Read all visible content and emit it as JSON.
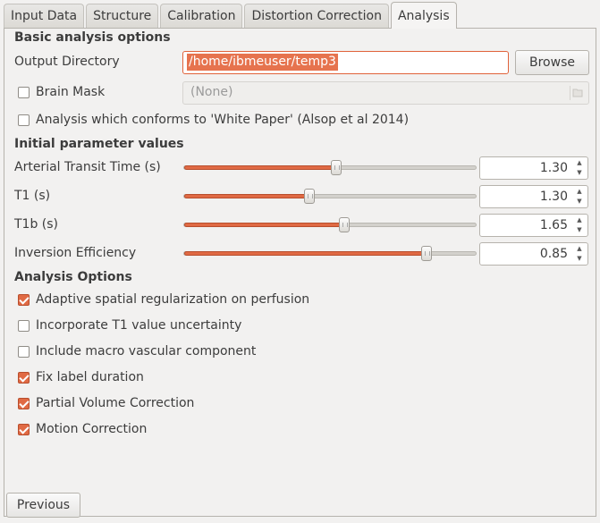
{
  "tabs": [
    "Input Data",
    "Structure",
    "Calibration",
    "Distortion Correction",
    "Analysis"
  ],
  "active_tab": "Analysis",
  "basic": {
    "title": "Basic analysis options",
    "output_dir_label": "Output Directory",
    "output_dir_value": "/home/ibmeuser/temp3",
    "browse_label": "Browse",
    "brain_mask_label": "Brain Mask",
    "brain_mask_value": "(None)",
    "white_paper_label": "Analysis which conforms to 'White Paper' (Alsop et al 2014)"
  },
  "params": {
    "title": "Initial parameter values",
    "items": [
      {
        "label": "Arterial Transit Time (s)",
        "value": "1.30",
        "fraction": 0.52
      },
      {
        "label": "T1 (s)",
        "value": "1.30",
        "fraction": 0.43
      },
      {
        "label": "T1b (s)",
        "value": "1.65",
        "fraction": 0.55
      },
      {
        "label": "Inversion Efficiency",
        "value": "0.85",
        "fraction": 0.83
      }
    ]
  },
  "options": {
    "title": "Analysis Options",
    "items": [
      {
        "label": "Adaptive spatial regularization on perfusion",
        "checked": true
      },
      {
        "label": "Incorporate T1 value uncertainty",
        "checked": false
      },
      {
        "label": "Include macro vascular component",
        "checked": false
      },
      {
        "label": "Fix label duration",
        "checked": true
      },
      {
        "label": "Partial Volume Correction",
        "checked": true
      },
      {
        "label": "Motion Correction",
        "checked": true
      }
    ]
  },
  "previous_label": "Previous",
  "colors": {
    "accent": "#e06a44",
    "background": "#f2f1f0"
  },
  "icons": {
    "folder": "folder-icon",
    "spin_up": "chevron-up-icon",
    "spin_down": "chevron-down-icon"
  }
}
